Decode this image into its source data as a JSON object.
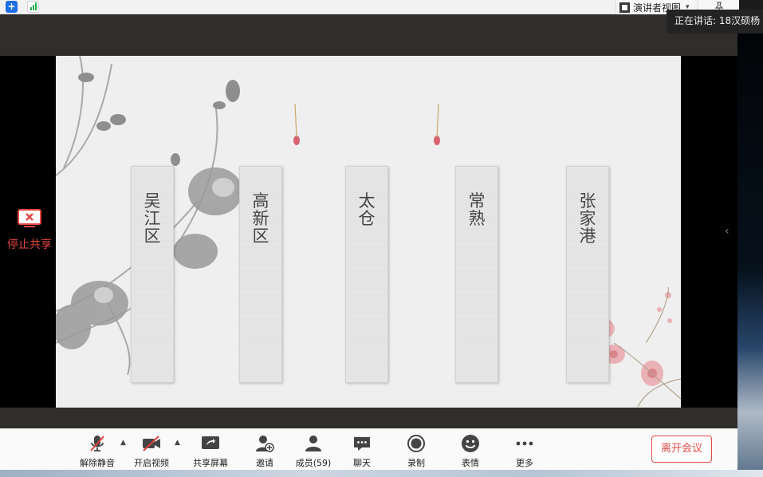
{
  "top_bar": {
    "plus_icon": "plus-square-icon",
    "signal_icon": "signal-bars-icon",
    "view_label": "演讲者视图",
    "view_caret": "▾",
    "pin_icon": "pin-icon"
  },
  "speaking": {
    "text": "正在讲话: 18汉硕杨"
  },
  "share": {
    "stop_label": "停止共享",
    "stop_icon": "stop-share-icon"
  },
  "slide": {
    "panels": [
      {
        "label": "吴江区"
      },
      {
        "label": "高新区"
      },
      {
        "label": "太仓"
      },
      {
        "label": "常熟"
      },
      {
        "label": "张家港"
      }
    ],
    "next_arrow": "‹"
  },
  "toolbar": {
    "items": [
      {
        "label": "解除静音",
        "icon": "microphone-muted-icon"
      },
      {
        "label": "开启视频",
        "icon": "video-off-icon"
      },
      {
        "label": "共享屏幕",
        "icon": "share-screen-icon"
      },
      {
        "label": "邀请",
        "icon": "invite-user-icon"
      },
      {
        "label": "成员(59)",
        "icon": "members-icon"
      },
      {
        "label": "聊天",
        "icon": "chat-icon"
      },
      {
        "label": "录制",
        "icon": "record-icon"
      },
      {
        "label": "表情",
        "icon": "emoji-icon"
      },
      {
        "label": "更多",
        "icon": "more-icon"
      }
    ],
    "caret": "▲",
    "leave_label": "离开会议"
  },
  "colors": {
    "accent_red": "#e14b47",
    "toolbar_bg": "#fafafa",
    "stage_band": "#2f2e2b"
  }
}
